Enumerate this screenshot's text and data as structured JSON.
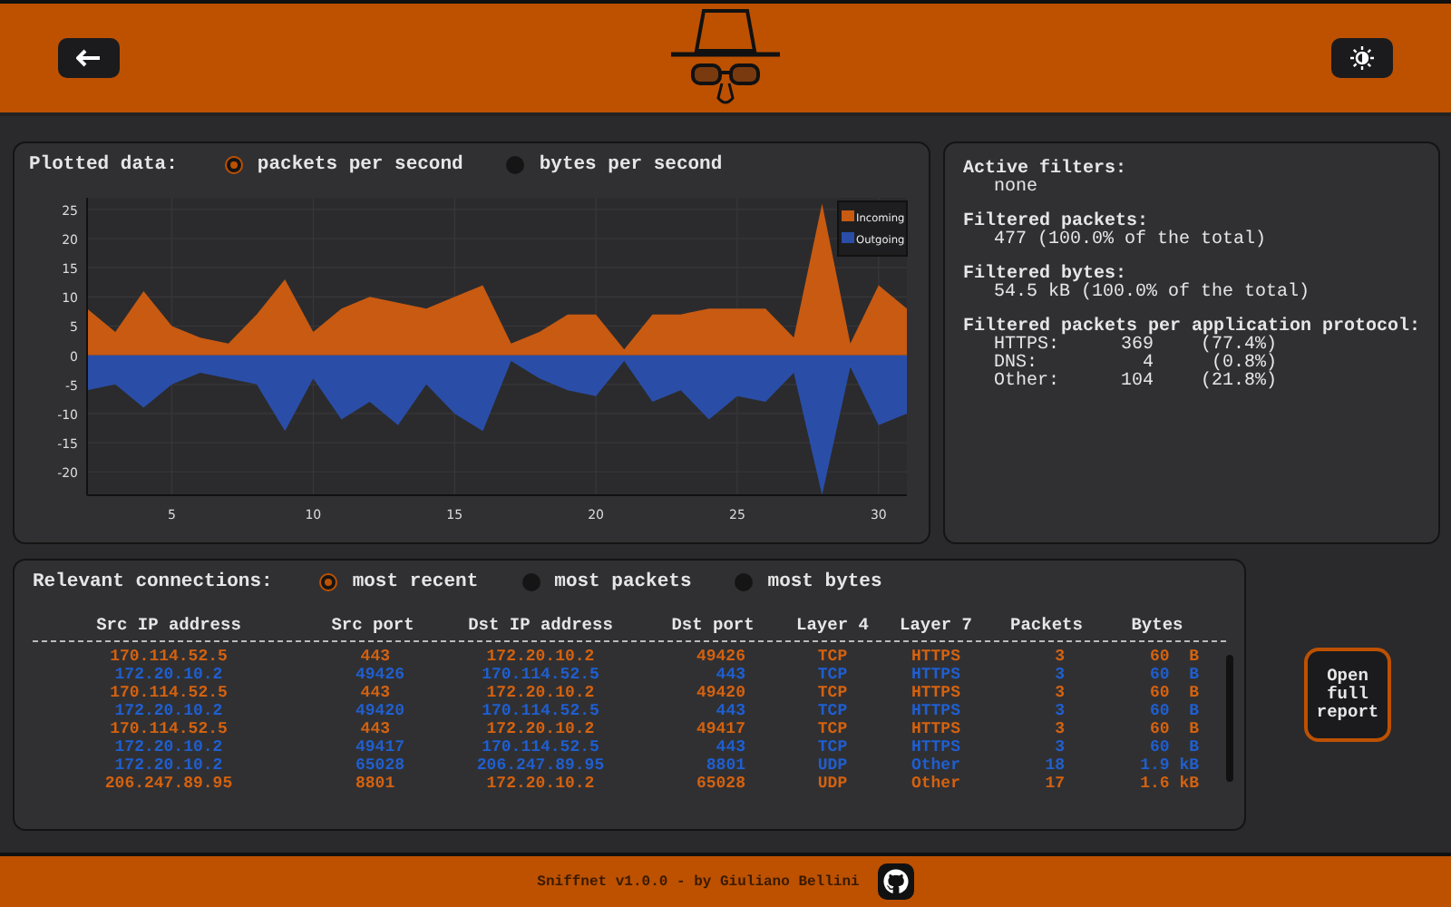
{
  "chart_panel": {
    "title": "Plotted data:",
    "options": [
      {
        "label": "packets per second",
        "selected": true
      },
      {
        "label": "bytes per second",
        "selected": false
      }
    ],
    "chart_data": {
      "type": "area",
      "grid": true,
      "legend": true,
      "x": [
        2,
        3,
        4,
        5,
        6,
        7,
        8,
        9,
        10,
        11,
        12,
        13,
        14,
        15,
        16,
        17,
        18,
        19,
        20,
        21,
        22,
        23,
        24,
        25,
        26,
        27,
        28,
        29,
        30,
        31
      ],
      "xlim": [
        2,
        31
      ],
      "ylim": [
        -24,
        27
      ],
      "xticks": [
        5,
        10,
        15,
        20,
        25,
        30
      ],
      "yticks": [
        -20,
        -15,
        -10,
        -5,
        0,
        5,
        10,
        15,
        20,
        25
      ],
      "series": [
        {
          "name": "Incoming",
          "color": "#c85a12",
          "values": [
            8,
            4,
            11,
            5,
            3,
            2,
            7,
            13,
            4,
            8,
            10,
            9,
            8,
            10,
            12,
            2,
            4,
            7,
            7,
            1,
            7,
            7,
            8,
            8,
            8,
            3,
            26,
            2,
            12,
            8
          ]
        },
        {
          "name": "Outgoing",
          "color": "#2a4ea8",
          "values": [
            -6,
            -5,
            -9,
            -5,
            -3,
            -4,
            -5,
            -13,
            -4,
            -11,
            -8,
            -12,
            -5,
            -10,
            -13,
            -1,
            -4,
            -6,
            -7,
            -1,
            -8,
            -6,
            -11,
            -7,
            -8,
            -3,
            -24,
            -2,
            -12,
            -10
          ]
        }
      ]
    }
  },
  "stats_panel": {
    "sections": [
      {
        "heading": "Active filters:",
        "lines": [
          "none"
        ]
      },
      {
        "heading": "Filtered packets:",
        "lines": [
          "477 (100.0% of the total)"
        ]
      },
      {
        "heading": "Filtered bytes:",
        "lines": [
          "54.5 kB (100.0% of the total)"
        ]
      }
    ],
    "protocols_heading": "Filtered packets per application protocol:",
    "protocols": [
      {
        "name": "HTTPS:",
        "count": "369",
        "share": "(77.4%)"
      },
      {
        "name": "DNS:",
        "count": "4",
        "share": "(0.8%)"
      },
      {
        "name": "Other:",
        "count": "104",
        "share": "(21.8%)"
      }
    ]
  },
  "connections": {
    "title": "Relevant connections:",
    "options": [
      {
        "label": "most recent",
        "selected": true
      },
      {
        "label": "most packets",
        "selected": false
      },
      {
        "label": "most bytes",
        "selected": false
      }
    ],
    "columns": [
      "Src IP address",
      "Src port",
      "Dst IP address",
      "Dst port",
      "Layer 4",
      "Layer 7",
      "Packets",
      "Bytes"
    ],
    "rows": [
      {
        "color": "#d4620f",
        "cells": [
          "170.114.52.5",
          "443",
          "172.20.10.2",
          "49426",
          "TCP",
          "HTTPS",
          "3",
          "60  B"
        ]
      },
      {
        "color": "#1f5fd0",
        "cells": [
          "172.20.10.2",
          "49426",
          "170.114.52.5",
          "443",
          "TCP",
          "HTTPS",
          "3",
          "60  B"
        ]
      },
      {
        "color": "#d4620f",
        "cells": [
          "170.114.52.5",
          "443",
          "172.20.10.2",
          "49420",
          "TCP",
          "HTTPS",
          "3",
          "60  B"
        ]
      },
      {
        "color": "#1f5fd0",
        "cells": [
          "172.20.10.2",
          "49420",
          "170.114.52.5",
          "443",
          "TCP",
          "HTTPS",
          "3",
          "60  B"
        ]
      },
      {
        "color": "#d4620f",
        "cells": [
          "170.114.52.5",
          "443",
          "172.20.10.2",
          "49417",
          "TCP",
          "HTTPS",
          "3",
          "60  B"
        ]
      },
      {
        "color": "#1f5fd0",
        "cells": [
          "172.20.10.2",
          "49417",
          "170.114.52.5",
          "443",
          "TCP",
          "HTTPS",
          "3",
          "60  B"
        ]
      },
      {
        "color": "#1f5fd0",
        "cells": [
          "172.20.10.2",
          "65028",
          "206.247.89.95",
          "8801",
          "UDP",
          "Other",
          "18",
          "1.9 kB"
        ]
      },
      {
        "color": "#d4620f",
        "cells": [
          "206.247.89.95",
          "8801",
          "172.20.10.2",
          "65028",
          "UDP",
          "Other",
          "17",
          "1.6 kB"
        ]
      }
    ]
  },
  "report_button": {
    "label": "Open full report"
  },
  "footer": {
    "text": "Sniffnet v1.0.0 - by Giuliano Bellini"
  }
}
